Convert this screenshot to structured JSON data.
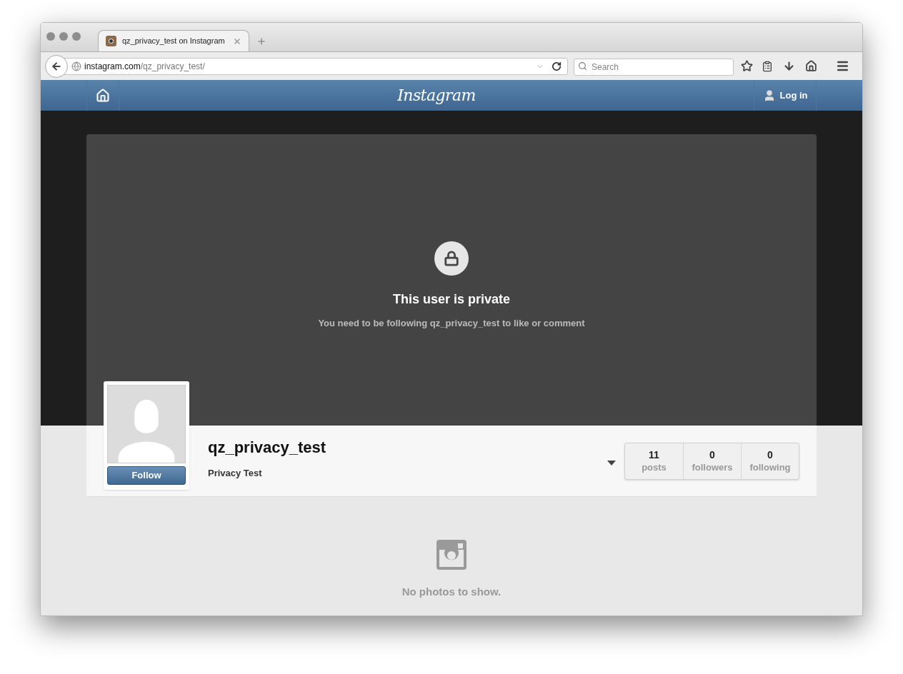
{
  "browser": {
    "tab": {
      "title": "qz_privacy_test on Instagram",
      "selected": true
    },
    "url": {
      "host": "instagram.com",
      "path": "/qz_privacy_test/"
    },
    "search": {
      "placeholder": "Search"
    }
  },
  "site": {
    "logo": "Instagram",
    "login": "Log in"
  },
  "private_notice": {
    "title": "This user is private",
    "message": "You need to be following qz_privacy_test to like or comment"
  },
  "profile": {
    "username": "qz_privacy_test",
    "full_name": "Privacy Test",
    "follow": "Follow"
  },
  "stats": [
    {
      "value": "11",
      "label": "posts"
    },
    {
      "value": "0",
      "label": "followers"
    },
    {
      "value": "0",
      "label": "following"
    }
  ],
  "empty": "No photos to show."
}
